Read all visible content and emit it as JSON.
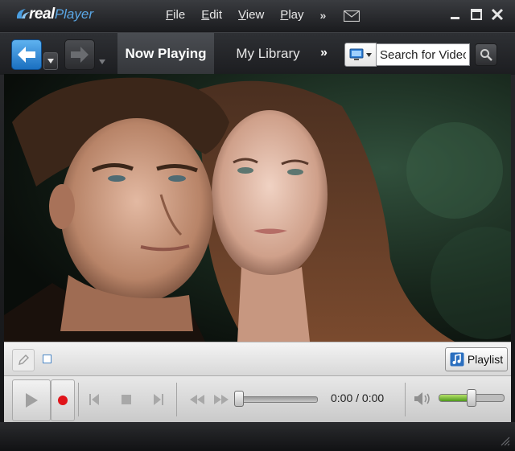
{
  "app": {
    "logo_real": "real",
    "logo_player": "Player"
  },
  "menu": {
    "items": [
      {
        "label": "File"
      },
      {
        "label": "Edit"
      },
      {
        "label": "View"
      },
      {
        "label": "Play"
      }
    ],
    "more": "»",
    "mail_icon": "envelope-icon"
  },
  "window_controls": [
    "minimize-icon",
    "maximize-icon",
    "close-icon"
  ],
  "nav": {
    "tabs": [
      {
        "label": "Now Playing",
        "active": true
      },
      {
        "label": "My Library",
        "active": false
      }
    ],
    "more": "»",
    "search": {
      "value": "Search for Video",
      "type_icon": "monitor-icon",
      "go_icon": "magnifier-icon"
    }
  },
  "toolstrip": {
    "playlist_label": "Playlist"
  },
  "player": {
    "time": "0:00 / 0:00",
    "position": 0,
    "volume": 0.5
  },
  "colors": {
    "accent_blue": "#1a6fc0",
    "record_red": "#e0141a",
    "volume_green": "#5aa71f"
  }
}
